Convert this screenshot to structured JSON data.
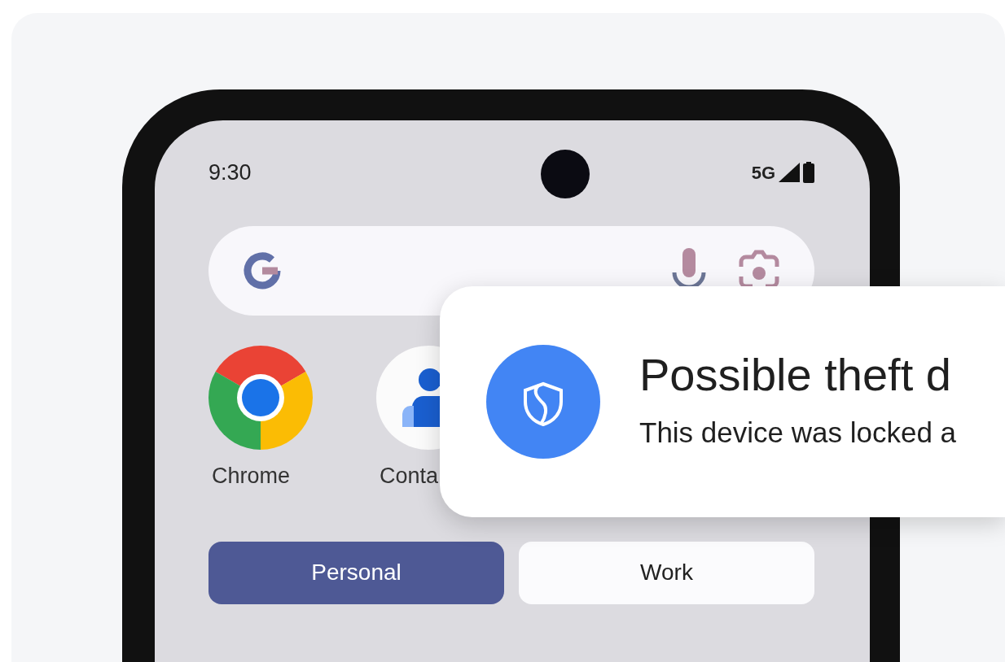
{
  "status_bar": {
    "time": "9:30",
    "network": "5G"
  },
  "apps": [
    {
      "label": "Chrome",
      "kind": "chrome"
    },
    {
      "label": "Conta",
      "kind": "contacts"
    }
  ],
  "profile_tabs": [
    {
      "label": "Personal",
      "selected": true
    },
    {
      "label": "Work",
      "selected": false
    }
  ],
  "notification": {
    "title": "Possible theft d",
    "message": "This device was locked a"
  }
}
